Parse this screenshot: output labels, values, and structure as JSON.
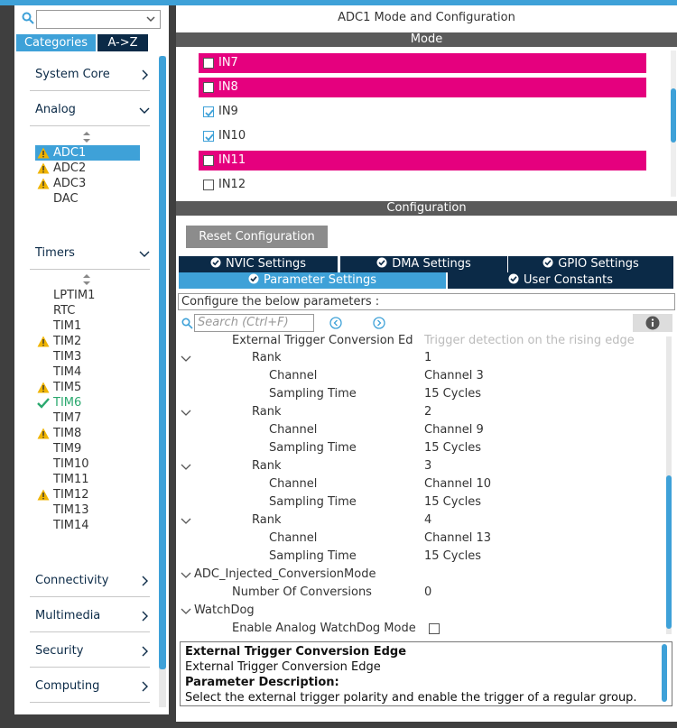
{
  "left_panel": {
    "tabs": {
      "categories": "Categories",
      "az": "A->Z"
    },
    "categories": [
      {
        "label": "System Core",
        "state": "collapsed"
      },
      {
        "label": "Analog",
        "state": "expanded"
      },
      {
        "label": "Timers",
        "state": "expanded"
      },
      {
        "label": "Connectivity",
        "state": "collapsed"
      },
      {
        "label": "Multimedia",
        "state": "collapsed"
      },
      {
        "label": "Security",
        "state": "collapsed"
      },
      {
        "label": "Computing",
        "state": "collapsed"
      }
    ],
    "analog_items": [
      {
        "name": "ADC1",
        "status": "warning",
        "selected": true
      },
      {
        "name": "ADC2",
        "status": "warning"
      },
      {
        "name": "ADC3",
        "status": "warning"
      },
      {
        "name": "DAC",
        "status": "none"
      }
    ],
    "timer_items": [
      {
        "name": "LPTIM1",
        "status": "none"
      },
      {
        "name": "RTC",
        "status": "none"
      },
      {
        "name": "TIM1",
        "status": "none"
      },
      {
        "name": "TIM2",
        "status": "warning"
      },
      {
        "name": "TIM3",
        "status": "none"
      },
      {
        "name": "TIM4",
        "status": "none"
      },
      {
        "name": "TIM5",
        "status": "warning"
      },
      {
        "name": "TIM6",
        "status": "ok"
      },
      {
        "name": "TIM7",
        "status": "none"
      },
      {
        "name": "TIM8",
        "status": "warning"
      },
      {
        "name": "TIM9",
        "status": "none"
      },
      {
        "name": "TIM10",
        "status": "none"
      },
      {
        "name": "TIM11",
        "status": "none"
      },
      {
        "name": "TIM12",
        "status": "warning"
      },
      {
        "name": "TIM13",
        "status": "none"
      },
      {
        "name": "TIM14",
        "status": "none"
      }
    ]
  },
  "main": {
    "title": "ADC1 Mode and Configuration",
    "mode_header": "Mode",
    "pins": [
      {
        "label": "IN7",
        "checked": false,
        "highlight": true
      },
      {
        "label": "IN8",
        "checked": false,
        "highlight": true
      },
      {
        "label": "IN9",
        "checked": true,
        "highlight": false
      },
      {
        "label": "IN10",
        "checked": true,
        "highlight": false
      },
      {
        "label": "IN11",
        "checked": false,
        "highlight": true
      },
      {
        "label": "IN12",
        "checked": false,
        "highlight": false
      }
    ],
    "config_header": "Configuration",
    "reset_button": "Reset Configuration",
    "tabs_row1": [
      "NVIC Settings",
      "DMA Settings",
      "GPIO Settings"
    ],
    "tabs_row2": [
      "Parameter Settings",
      "User Constants"
    ],
    "active_tab": "Parameter Settings",
    "configure_hint": "Configure the below parameters :",
    "search_placeholder": "Search (Ctrl+F)",
    "tree": {
      "clipped_row": {
        "key": "External Trigger Conversion Ed",
        "value": "Trigger detection on the rising edge"
      },
      "ranks": [
        {
          "label": "Rank",
          "value": "1",
          "channel_label": "Channel",
          "channel": "Channel 3",
          "sampling_label": "Sampling Time",
          "sampling": "15 Cycles"
        },
        {
          "label": "Rank",
          "value": "2",
          "channel_label": "Channel",
          "channel": "Channel 9",
          "sampling_label": "Sampling Time",
          "sampling": "15 Cycles"
        },
        {
          "label": "Rank",
          "value": "3",
          "channel_label": "Channel",
          "channel": "Channel 10",
          "sampling_label": "Sampling Time",
          "sampling": "15 Cycles"
        },
        {
          "label": "Rank",
          "value": "4",
          "channel_label": "Channel",
          "channel": "Channel 13",
          "sampling_label": "Sampling Time",
          "sampling": "15 Cycles"
        }
      ],
      "injected_group": "ADC_Injected_ConversionMode",
      "num_conversions_label": "Number Of Conversions",
      "num_conversions_value": "0",
      "watchdog_group": "WatchDog",
      "watchdog_label": "Enable Analog WatchDog Mode"
    },
    "description": {
      "title": "External Trigger Conversion Edge",
      "subtitle": "External Trigger Conversion Edge",
      "param_label": "Parameter Description:",
      "text": "Select the external trigger polarity and enable the trigger of a regular group."
    }
  },
  "colors": {
    "accent": "#3ea1d8",
    "navy": "#0b2a47",
    "pink": "#e5007e",
    "warning": "#f0b400",
    "ok": "#2aa86e"
  }
}
